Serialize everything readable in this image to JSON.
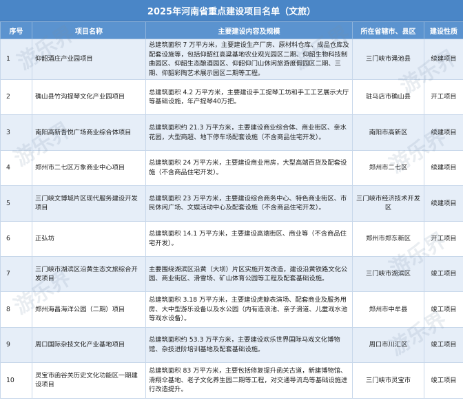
{
  "title": "2025年河南省重点建设项目名单（文旅）",
  "headers": [
    "序号",
    "项目名称",
    "主要建设内容及规模",
    "所在省辖市、县区",
    "建设性质"
  ],
  "rows": [
    {
      "no": "1",
      "name": "仰韶酒庄产业园项目",
      "content": "总建筑面积 7 万平方米，主要建设生产厂房、原材料仓库、成品仓库及配套设施等，包括仰韶红高粱基地农业观光园区二期、仰韶生物科技制曲园区、仰韶生态酿酒园区、仰韶仰门山休闲旅游度假园区二期、三期、仰韶彩陶艺术展示园区二期等工程。",
      "region": "三门峡市渑池县",
      "nature": "续建项目"
    },
    {
      "no": "2",
      "name": "确山县竹沟提琴文化产业园项目",
      "content": "总建筑面积 4.2 万平方米，主要建设手工提琴工坊和手工工艺展示大厅等基础设施，年产提琴40万把。",
      "region": "驻马店市确山县",
      "nature": "开工项目"
    },
    {
      "no": "3",
      "name": "南阳高新吾悦广场商业综合体项目",
      "content": "总建筑面积约 21.3 万平方米，主要建设商业综合体、商业街区、亲水花园，大型商超、地下停车场配套设施（不含商品住宅开发）。",
      "region": "南阳市高新区",
      "nature": "续建项目"
    },
    {
      "no": "4",
      "name": "郑州市二七区万象商业中心项目",
      "content": "总建筑面积 24 万平方米，主要建设商业用房，大型高端百货及配套设施（不含商品住宅开发）。",
      "region": "郑州市二七区",
      "nature": "续建项目"
    },
    {
      "no": "5",
      "name": "三门峡文博城片区现代服务建设开发项目",
      "content": "总建筑面积 23 万平方米，主要建设综合商务中心、特色商业街区、市民休闲广场、文娱活动中心及配套设施（不含商品住宅开发）。",
      "region": "三门峡市经济技术开发区",
      "nature": "续建项目"
    },
    {
      "no": "6",
      "name": "正弘坊",
      "content": "总建筑面积 14.1 万平方米，主要建设高端街区、商业等（不含商品住宅开发）。",
      "region": "郑州市郑东新区",
      "nature": "开工项目"
    },
    {
      "no": "7",
      "name": "三门峡市湖滨区沿黄生态文旅综合开发项目",
      "content": "主要围绕湖滨区沿黄（大坝）片区实施开发改造，建设沿黄铁路文化公园、商业街区、滑雪场、矿山体育公园等工程及配套基础设施。",
      "region": "三门峡市湖滨区",
      "nature": "竣工项目"
    },
    {
      "no": "8",
      "name": "郑州海昌海洋公园（二期）项目",
      "content": "总建筑面积 3.18 万平方米，主要建设虎鲸表演场、配套商业及服务用房、大中型游乐设备以及水公园（内有造浪池、亲子滑道、儿童戏水池等戏水设备）。",
      "region": "郑州市中牟县",
      "nature": "竣工项目"
    },
    {
      "no": "9",
      "name": "周口国际杂技文化产业基地项目",
      "content": "总建筑面积约 53.3 万平方米，主要建设欢乐世界国际马戏文化博物馆、杂技进阶培训基地及配套基础设施。",
      "region": "周口市川汇区",
      "nature": "竣工项目"
    },
    {
      "no": "10",
      "name": "灵宝市函谷关历史文化功能区一期建设项目",
      "content": "总建筑面积 83 万平方米，主要包括修复提升函关古道，新建博物馆、滑翔伞基地、老子文化养生园二期等工程，对交通导流岛等基础设施进行改造提升。",
      "region": "三门峡市灵宝市",
      "nature": "竣工项目"
    }
  ],
  "watermark_text": "游乐界"
}
